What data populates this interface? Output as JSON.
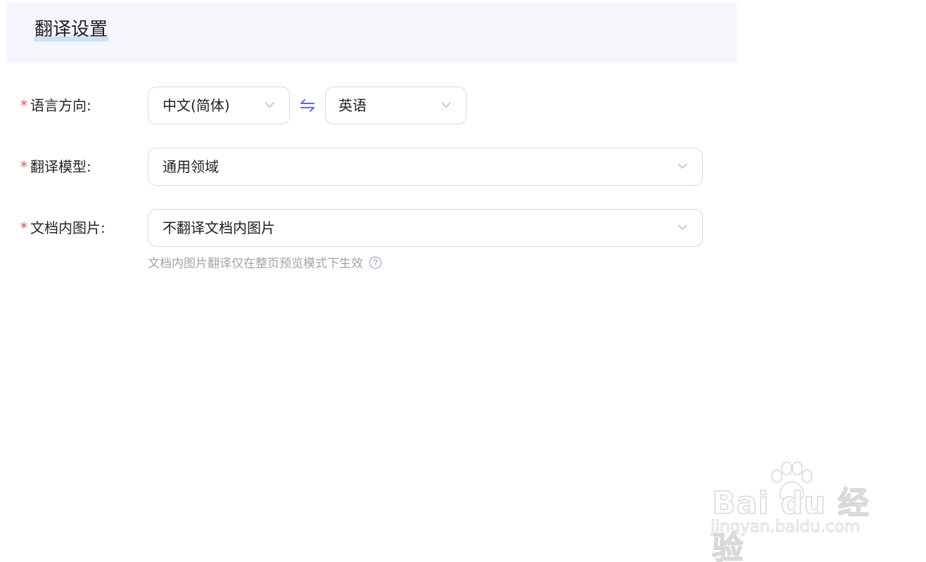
{
  "header": {
    "title": "翻译设置"
  },
  "form": {
    "language_direction": {
      "required_mark": "*",
      "label": "语言方向:",
      "source_value": "中文(简体)",
      "target_value": "英语",
      "swap_icon": "swap-arrows-icon"
    },
    "translation_model": {
      "required_mark": "*",
      "label": "翻译模型:",
      "value": "通用领域"
    },
    "doc_images": {
      "required_mark": "*",
      "label": "文档内图片:",
      "value": "不翻译文档内图片",
      "hint": "文档内图片翻译仅在整页预览模式下生效",
      "hint_icon": "help-circle-icon"
    }
  },
  "watermark": {
    "brand": "Bai du 经验",
    "url": "jingyan.baidu.com"
  },
  "colors": {
    "header_bg": "#f5f6fb",
    "required": "#f04d4d",
    "swap_icon": "#5b6cd9",
    "hint_text": "#a3a3ad",
    "border": "#d9d9e0"
  }
}
